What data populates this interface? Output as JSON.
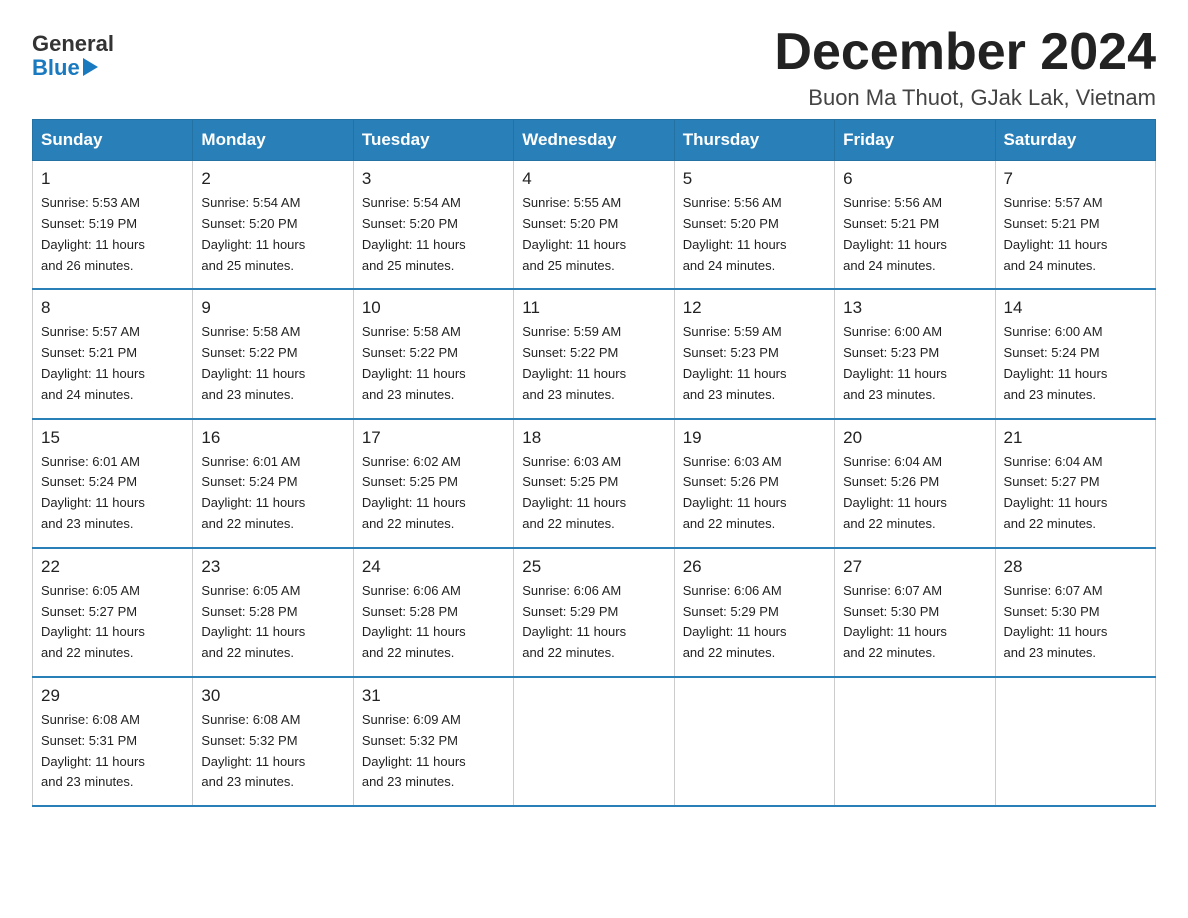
{
  "header": {
    "logo_general": "General",
    "logo_blue": "Blue",
    "title": "December 2024",
    "subtitle": "Buon Ma Thuot, GJak Lak, Vietnam"
  },
  "weekdays": [
    "Sunday",
    "Monday",
    "Tuesday",
    "Wednesday",
    "Thursday",
    "Friday",
    "Saturday"
  ],
  "weeks": [
    [
      {
        "day": "1",
        "sunrise": "5:53 AM",
        "sunset": "5:19 PM",
        "daylight": "11 hours and 26 minutes."
      },
      {
        "day": "2",
        "sunrise": "5:54 AM",
        "sunset": "5:20 PM",
        "daylight": "11 hours and 25 minutes."
      },
      {
        "day": "3",
        "sunrise": "5:54 AM",
        "sunset": "5:20 PM",
        "daylight": "11 hours and 25 minutes."
      },
      {
        "day": "4",
        "sunrise": "5:55 AM",
        "sunset": "5:20 PM",
        "daylight": "11 hours and 25 minutes."
      },
      {
        "day": "5",
        "sunrise": "5:56 AM",
        "sunset": "5:20 PM",
        "daylight": "11 hours and 24 minutes."
      },
      {
        "day": "6",
        "sunrise": "5:56 AM",
        "sunset": "5:21 PM",
        "daylight": "11 hours and 24 minutes."
      },
      {
        "day": "7",
        "sunrise": "5:57 AM",
        "sunset": "5:21 PM",
        "daylight": "11 hours and 24 minutes."
      }
    ],
    [
      {
        "day": "8",
        "sunrise": "5:57 AM",
        "sunset": "5:21 PM",
        "daylight": "11 hours and 24 minutes."
      },
      {
        "day": "9",
        "sunrise": "5:58 AM",
        "sunset": "5:22 PM",
        "daylight": "11 hours and 23 minutes."
      },
      {
        "day": "10",
        "sunrise": "5:58 AM",
        "sunset": "5:22 PM",
        "daylight": "11 hours and 23 minutes."
      },
      {
        "day": "11",
        "sunrise": "5:59 AM",
        "sunset": "5:22 PM",
        "daylight": "11 hours and 23 minutes."
      },
      {
        "day": "12",
        "sunrise": "5:59 AM",
        "sunset": "5:23 PM",
        "daylight": "11 hours and 23 minutes."
      },
      {
        "day": "13",
        "sunrise": "6:00 AM",
        "sunset": "5:23 PM",
        "daylight": "11 hours and 23 minutes."
      },
      {
        "day": "14",
        "sunrise": "6:00 AM",
        "sunset": "5:24 PM",
        "daylight": "11 hours and 23 minutes."
      }
    ],
    [
      {
        "day": "15",
        "sunrise": "6:01 AM",
        "sunset": "5:24 PM",
        "daylight": "11 hours and 23 minutes."
      },
      {
        "day": "16",
        "sunrise": "6:01 AM",
        "sunset": "5:24 PM",
        "daylight": "11 hours and 22 minutes."
      },
      {
        "day": "17",
        "sunrise": "6:02 AM",
        "sunset": "5:25 PM",
        "daylight": "11 hours and 22 minutes."
      },
      {
        "day": "18",
        "sunrise": "6:03 AM",
        "sunset": "5:25 PM",
        "daylight": "11 hours and 22 minutes."
      },
      {
        "day": "19",
        "sunrise": "6:03 AM",
        "sunset": "5:26 PM",
        "daylight": "11 hours and 22 minutes."
      },
      {
        "day": "20",
        "sunrise": "6:04 AM",
        "sunset": "5:26 PM",
        "daylight": "11 hours and 22 minutes."
      },
      {
        "day": "21",
        "sunrise": "6:04 AM",
        "sunset": "5:27 PM",
        "daylight": "11 hours and 22 minutes."
      }
    ],
    [
      {
        "day": "22",
        "sunrise": "6:05 AM",
        "sunset": "5:27 PM",
        "daylight": "11 hours and 22 minutes."
      },
      {
        "day": "23",
        "sunrise": "6:05 AM",
        "sunset": "5:28 PM",
        "daylight": "11 hours and 22 minutes."
      },
      {
        "day": "24",
        "sunrise": "6:06 AM",
        "sunset": "5:28 PM",
        "daylight": "11 hours and 22 minutes."
      },
      {
        "day": "25",
        "sunrise": "6:06 AM",
        "sunset": "5:29 PM",
        "daylight": "11 hours and 22 minutes."
      },
      {
        "day": "26",
        "sunrise": "6:06 AM",
        "sunset": "5:29 PM",
        "daylight": "11 hours and 22 minutes."
      },
      {
        "day": "27",
        "sunrise": "6:07 AM",
        "sunset": "5:30 PM",
        "daylight": "11 hours and 22 minutes."
      },
      {
        "day": "28",
        "sunrise": "6:07 AM",
        "sunset": "5:30 PM",
        "daylight": "11 hours and 23 minutes."
      }
    ],
    [
      {
        "day": "29",
        "sunrise": "6:08 AM",
        "sunset": "5:31 PM",
        "daylight": "11 hours and 23 minutes."
      },
      {
        "day": "30",
        "sunrise": "6:08 AM",
        "sunset": "5:32 PM",
        "daylight": "11 hours and 23 minutes."
      },
      {
        "day": "31",
        "sunrise": "6:09 AM",
        "sunset": "5:32 PM",
        "daylight": "11 hours and 23 minutes."
      },
      null,
      null,
      null,
      null
    ]
  ]
}
